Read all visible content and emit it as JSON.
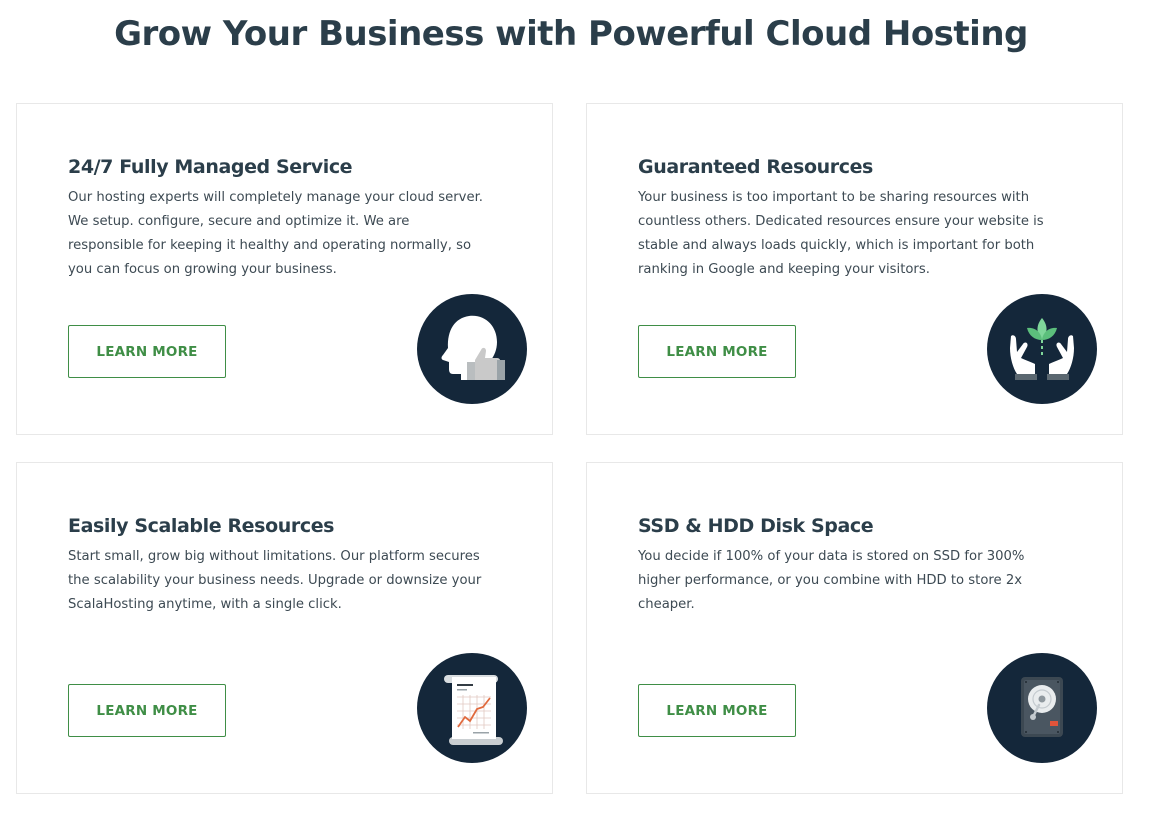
{
  "page": {
    "title": "Grow Your Business with Powerful Cloud Hosting"
  },
  "cards": [
    {
      "title": "24/7 Fully Managed Service",
      "text": "Our hosting experts will completely manage your cloud server. We setup. configure, secure and optimize it. We are responsible for keeping it healthy and operating normally, so you can focus on growing your business.",
      "button_label": "LEARN MORE",
      "icon": "head-thumbs-up-icon"
    },
    {
      "title": "Guaranteed Resources",
      "text": "Your business is too important to be sharing resources with countless others. Dedicated resources ensure your website is stable and always loads quickly, which is important for both ranking in Google and keeping your visitors.",
      "button_label": "LEARN MORE",
      "icon": "hands-plant-icon"
    },
    {
      "title": "Easily Scalable Resources",
      "text": "Start small, grow big without limitations. Our platform secures the scalability your business needs. Upgrade or downsize your ScalaHosting anytime, with a single click.",
      "button_label": "LEARN MORE",
      "icon": "growth-chart-scroll-icon"
    },
    {
      "title": "SSD & HDD Disk Space",
      "text": "You decide if 100% of your data is stored on SSD for 300% higher performance, or you combine with HDD to store 2x cheaper.",
      "button_label": "LEARN MORE",
      "icon": "hard-disk-icon"
    }
  ],
  "colors": {
    "accent_green": "#3f8e46",
    "heading": "#2b3e4a",
    "icon_circle": "#14273a",
    "card_border": "#e8e8e8"
  }
}
